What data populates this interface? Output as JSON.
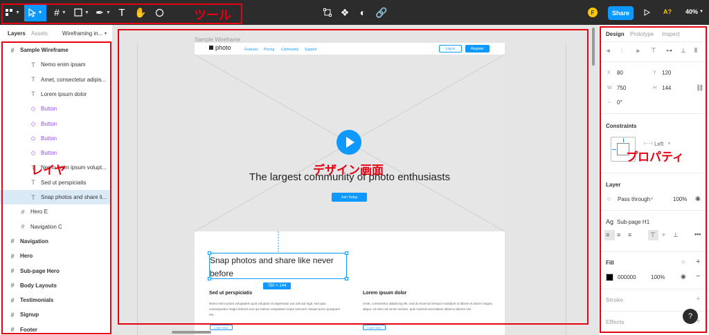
{
  "toolbar": {
    "tools": [
      "main-menu",
      "move",
      "frame",
      "shape",
      "pen",
      "text",
      "hand",
      "comment"
    ],
    "center_tools": [
      "crop-icon",
      "component-icon",
      "contrast-icon",
      "link-icon"
    ],
    "avatar_initial": "F",
    "share_label": "Share",
    "present_icon": "play-icon",
    "aa_label": "A?",
    "zoom": "40%"
  },
  "left_panel": {
    "tabs": [
      "Layers",
      "Assets",
      "Wireframing in..."
    ],
    "layers": [
      {
        "label": "Sample Wireframe",
        "type": "frame",
        "bold": true
      },
      {
        "label": "Nemo enim ipsam",
        "type": "text"
      },
      {
        "label": "Amet, consectetur adipis...",
        "type": "text"
      },
      {
        "label": "Lorem ipsum dolor",
        "type": "text"
      },
      {
        "label": "Button",
        "type": "component"
      },
      {
        "label": "Button",
        "type": "component"
      },
      {
        "label": "Button",
        "type": "component"
      },
      {
        "label": "Button",
        "type": "component"
      },
      {
        "label": "Nemo enim ipsum volupt...",
        "type": "text"
      },
      {
        "label": "Sed ut perspiciatis",
        "type": "text"
      },
      {
        "label": "Snap photos and share li...",
        "type": "text",
        "selected": true
      },
      {
        "label": "Hero E",
        "type": "frame"
      },
      {
        "label": "Navigation C",
        "type": "frame"
      },
      {
        "label": "Navigation",
        "type": "frame",
        "bold": true
      },
      {
        "label": "Hero",
        "type": "frame",
        "bold": true
      },
      {
        "label": "Sub-page Hero",
        "type": "frame",
        "bold": true
      },
      {
        "label": "Body Layouts",
        "type": "frame",
        "bold": true
      },
      {
        "label": "Testimonials",
        "type": "frame",
        "bold": true
      },
      {
        "label": "Signup",
        "type": "frame",
        "bold": true
      },
      {
        "label": "Footer",
        "type": "frame",
        "bold": true
      }
    ]
  },
  "canvas": {
    "frame_label": "Sample Wireframe",
    "logo": "photo",
    "nav_links": [
      "Features",
      "Pricing",
      "Community",
      "Support"
    ],
    "login_label": "Log in",
    "register_label": "Register",
    "hero_title": "The largest community of photo enthusiasts",
    "join_label": "Join Today",
    "selected_text": "Snap photos and share like never before",
    "dimension_badge": "750 × 144",
    "col1_title": "Sed ut perspiciatis",
    "col1_body": "Nemo enim ipsam voluptatem quia voluptas sit aspernatur aut odit aut fugit, sed quia consequuntur magni dolores eos qui ratione voluptatem sequi nesciunt. Neque porro quisquam est.",
    "col2_title": "Lorem ipsum dolor",
    "col2_body": "Amet, consectetur adipiscing elit, sed do eiusmod tempor incididunt ut labore et dolore magna aliqua. Ut enim ad minim veniam, quis nostrud exercitation ullamco laboris nisi.",
    "learn_label": "Learn more"
  },
  "right_panel": {
    "tabs": [
      "Design",
      "Prototype",
      "Inspect"
    ],
    "x_label": "X",
    "x": "80",
    "y_label": "Y",
    "y": "120",
    "w_label": "W",
    "w": "750",
    "h_label": "H",
    "h": "144",
    "rotation": "0°",
    "constraints_title": "Constraints",
    "constraint_h": "Left",
    "layer_title": "Layer",
    "blend_mode": "Pass through",
    "opacity": "100%",
    "text_style_prefix": "Ag",
    "text_style": "Sub-page H1",
    "fill_title": "Fill",
    "fill_hex": "000000",
    "fill_opacity": "100%",
    "fill_color": "#000000",
    "stroke_title": "Stroke",
    "effects_title": "Effects",
    "help_label": "?"
  },
  "annotations": {
    "tools_label": "ツール",
    "layers_label": "レイヤ",
    "design_label": "デザイン画面",
    "properties_label": "プロパティ",
    "color": "#e60012"
  }
}
